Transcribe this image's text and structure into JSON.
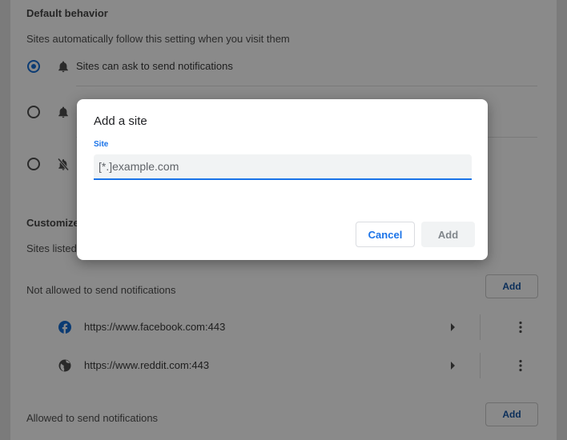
{
  "default_behavior": {
    "heading": "Default behavior",
    "description": "Sites automatically follow this setting when you visit them",
    "options": [
      {
        "label": "Sites can ask to send notifications",
        "selected": true
      }
    ]
  },
  "customized": {
    "heading": "Customize",
    "description": "Sites listed",
    "not_allowed": {
      "label": "Not allowed to send notifications",
      "add_label": "Add",
      "sites": [
        {
          "url": "https://www.facebook.com:443",
          "icon": "facebook-icon"
        },
        {
          "url": "https://www.reddit.com:443",
          "icon": "globe-icon"
        }
      ]
    },
    "allowed": {
      "label": "Allowed to send notifications",
      "add_label": "Add"
    }
  },
  "dialog": {
    "title": "Add a site",
    "field_label": "Site",
    "placeholder": "[*.]example.com",
    "cancel_label": "Cancel",
    "add_label": "Add"
  },
  "colors": {
    "accent": "#1a73e8",
    "overlay": "#8a8a8a"
  }
}
